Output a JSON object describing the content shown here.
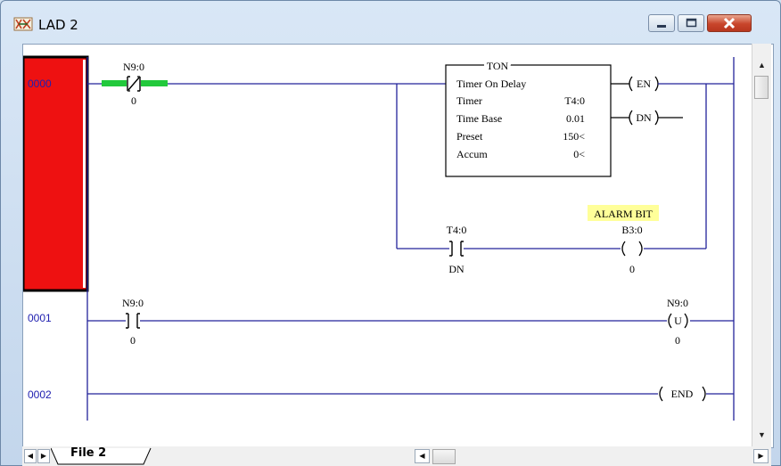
{
  "window": {
    "title": "LAD 2"
  },
  "rungs": [
    {
      "number": "0000"
    },
    {
      "number": "0001"
    },
    {
      "number": "0002"
    }
  ],
  "rung0": {
    "contact1": {
      "address": "N9:0",
      "state": "0"
    },
    "timer": {
      "header": "TON",
      "description": "Timer On Delay",
      "rows": [
        {
          "label": "Timer",
          "value": "T4:0"
        },
        {
          "label": "Time Base",
          "value": "0.01"
        },
        {
          "label": "Preset",
          "value": "150<"
        },
        {
          "label": "Accum",
          "value": "0<"
        }
      ],
      "outputs": [
        "EN",
        "DN"
      ]
    },
    "branch_contact": {
      "address": "T4:0",
      "bit": "DN"
    },
    "coil": {
      "address": "B3:0",
      "symbol": "ALARM BIT",
      "state": "0"
    }
  },
  "rung1": {
    "contact": {
      "address": "N9:0",
      "state": "0"
    },
    "coil": {
      "address": "N9:0",
      "type": "U",
      "state": "0"
    }
  },
  "rung2": {
    "end": "END"
  },
  "tabs": [
    {
      "label": "File 2"
    }
  ],
  "colors": {
    "rail": "#23239a",
    "energized": "#22c93c",
    "selection": "#ee1111",
    "symbol_bg": "#ffff99",
    "rung_number": "#2020b0"
  }
}
